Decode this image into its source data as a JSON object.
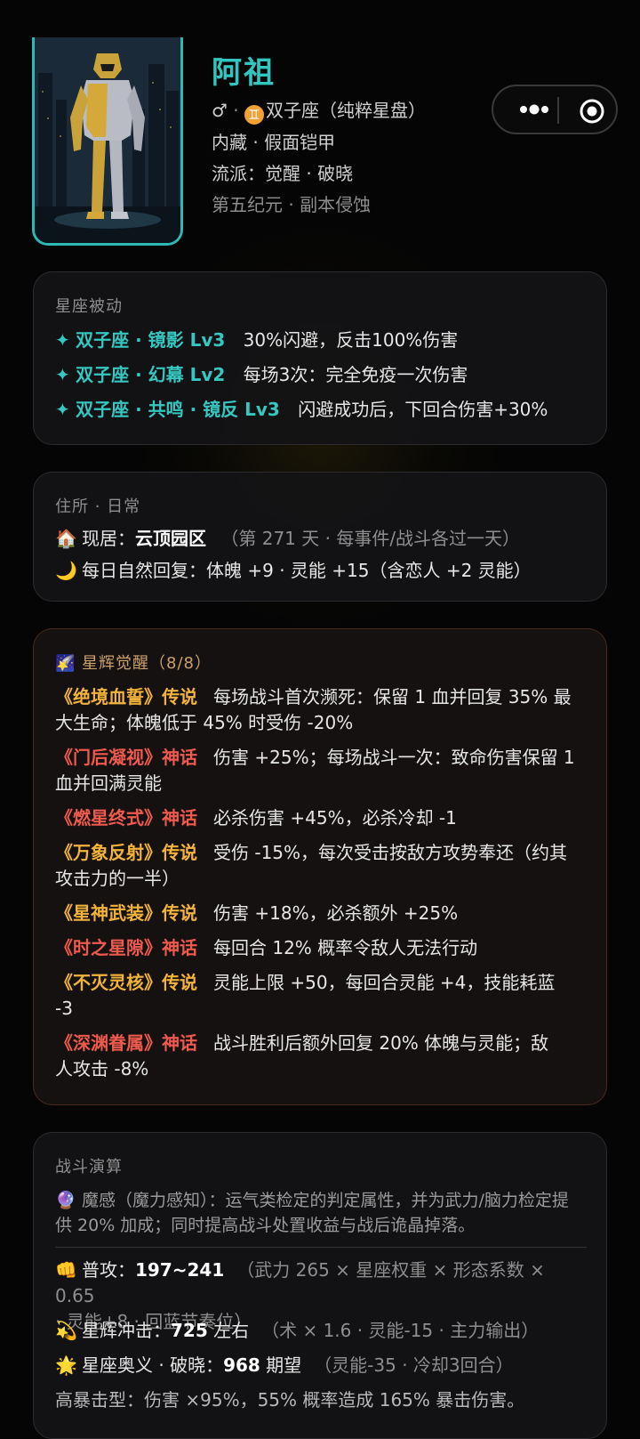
{
  "profile": {
    "name": "阿祖",
    "gender_symbol": "♂",
    "zodiac_glyph": "♊",
    "zodiac_label": "双子座（纯粹星盘）",
    "line2": "内藏 · 假面铠甲",
    "line3": "流派：觉醒 · 破晓",
    "line4": "第五纪元 · 副本侵蚀"
  },
  "capsule": {
    "more_icon": "more-dots-icon",
    "close_icon": "target-icon"
  },
  "zodiac_passive": {
    "title": "星座被动",
    "items": [
      {
        "star": "✦",
        "name": "双子座 · 镜影 Lv3",
        "desc": "30%闪避，反击100%伤害"
      },
      {
        "star": "✦",
        "name": "双子座 · 幻幕 Lv2",
        "desc": "每场3次：完全免疫一次伤害"
      },
      {
        "star": "✦",
        "name": "双子座 · 共鸣 · 镜反 Lv3",
        "desc": "闪避成功后，下回合伤害+30%"
      }
    ]
  },
  "residence": {
    "title": "住所 · 日常",
    "home_icon": "🏠",
    "home_label": "现居：",
    "home_value": "云顶园区",
    "home_note": "（第 271 天 · 每事件/战斗各过一天）",
    "moon_icon": "🌙",
    "recovery": "每日自然回复：体魄 +9 · 灵能 +15（含恋人 +2 灵能）"
  },
  "awakening": {
    "icon": "🌠",
    "title": "星辉觉醒（8/8）",
    "skills": [
      {
        "name": "《绝境血誓》传说",
        "tier": "gold",
        "desc_l1": "每场战斗首次濒死：保留 1 血并回复 35% 最",
        "desc_l2": "大生命；体魄低于 45% 时受伤 -20%"
      },
      {
        "name": "《门后凝视》神话",
        "tier": "red",
        "desc_l1": "伤害 +25%；每场战斗一次：致命伤害保留 1",
        "desc_l2": "血并回满灵能"
      },
      {
        "name": "《燃星终式》神话",
        "tier": "red",
        "desc_l1": "必杀伤害 +45%，必杀冷却 -1",
        "desc_l2": ""
      },
      {
        "name": "《万象反射》传说",
        "tier": "gold",
        "desc_l1": "受伤 -15%，每次受击按敌方攻势奉还（约其",
        "desc_l2": "攻击力的一半）"
      },
      {
        "name": "《星神武装》传说",
        "tier": "gold",
        "desc_l1": "伤害 +18%，必杀额外 +25%",
        "desc_l2": ""
      },
      {
        "name": "《时之星隙》神话",
        "tier": "red",
        "desc_l1": "每回合 12% 概率令敌人无法行动",
        "desc_l2": ""
      },
      {
        "name": "《不灭灵核》传说",
        "tier": "gold",
        "desc_l1": "灵能上限 +50，每回合灵能 +4，技能耗蓝",
        "desc_l2": "-3"
      },
      {
        "name": "《深渊眷属》神话",
        "tier": "red",
        "desc_l1": "战斗胜利后额外回复 20% 体魄与灵能；敌",
        "desc_l2": "人攻击 -8%"
      }
    ]
  },
  "combat": {
    "title": "战斗演算",
    "magic_icon": "🔮",
    "magic_l1": "魔感（魔力感知）：运气类检定的判定属性，并为武力/脑力检定提",
    "magic_l2": "供 20% 加成；同时提高战斗处置收益与战后诡晶掉落。",
    "attack_icon": "👊",
    "attack_label": "普攻：",
    "attack_value": "197~241",
    "attack_note_l1": "（武力 265 × 星座权重 × 形态系数 × 0.65",
    "attack_note_l2": "· 灵能+8 · 回蓝节奏位）",
    "strike_icon": "💫",
    "strike_label": "星辉冲击：",
    "strike_value": "725",
    "strike_suffix": " 左右",
    "strike_note": "（术 × 1.6 · 灵能-15 · 主力输出）",
    "ult_icon": "🌟",
    "ult_label": "星座奥义 · 破晓：",
    "ult_value": "968",
    "ult_suffix": " 期望",
    "ult_note": "（灵能-35 · 冷却3回合）",
    "crit_line": "高暴击型：伤害 ×95%，55% 概率造成 165% 暴击伤害。"
  }
}
